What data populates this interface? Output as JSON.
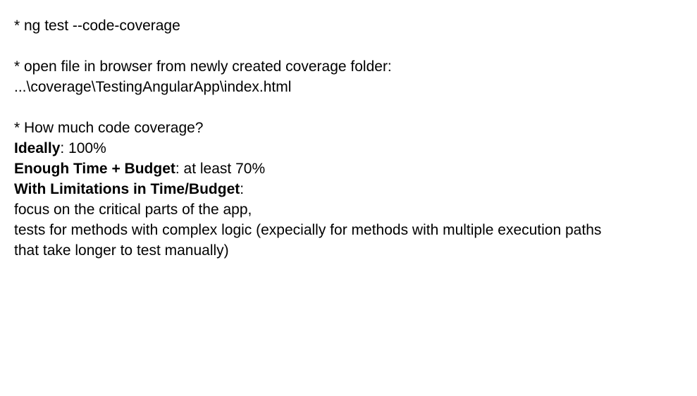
{
  "notes": {
    "cmd_line": "* ng test --code-coverage",
    "open_line": "* open file in browser from newly created coverage folder:",
    "path_line": "...\\coverage\\TestingAngularApp\\index.html",
    "question_line": "* How much code coverage?",
    "ideally": {
      "label": "Ideally",
      "value": ": 100%"
    },
    "enough": {
      "label": "Enough Time + Budget",
      "value": ": at least 70%"
    },
    "limited": {
      "label": "With Limitations in Time/Budget",
      "value": ":"
    },
    "focus_line": "focus on the critical parts of the app,",
    "tests_line": "tests for methods with complex logic (expecially for methods with multiple execution paths",
    "manual_line": "that take longer to test manually)"
  }
}
